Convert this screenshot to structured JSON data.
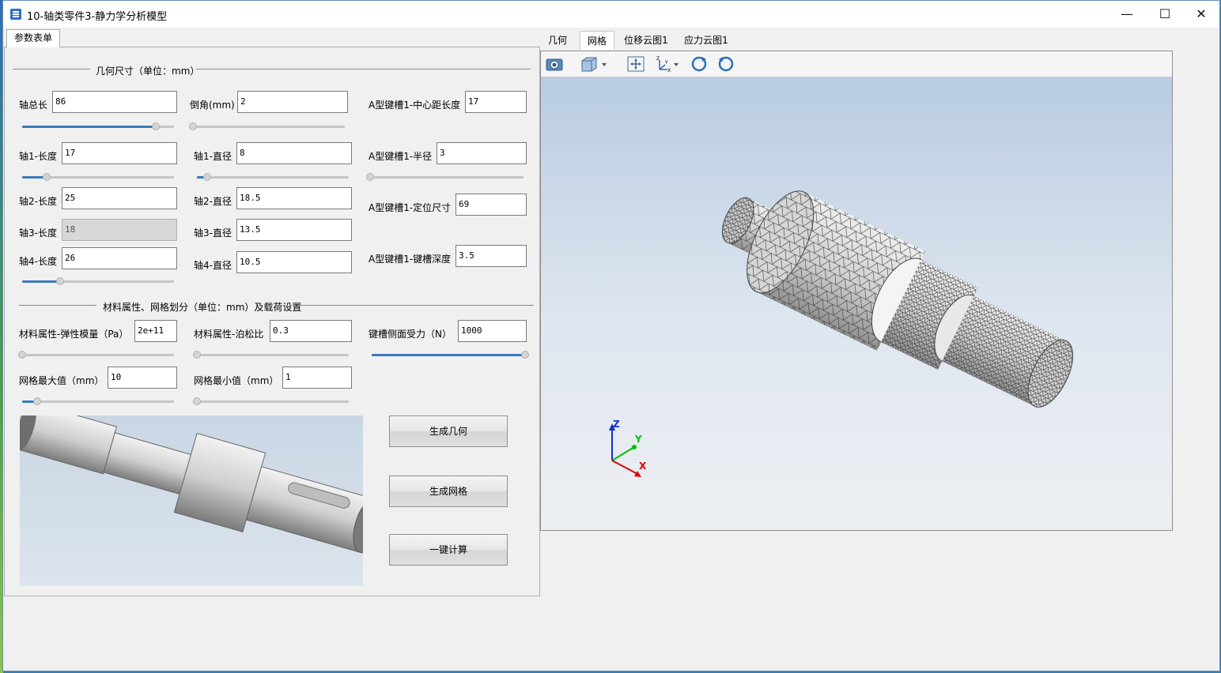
{
  "window": {
    "title": "10-轴类零件3-静力学分析模型"
  },
  "left_panel": {
    "tab": "参数表单",
    "section1": "几何尺寸（单位：mm）",
    "section2": "材料属性、网格划分（单位：mm）及载荷设置",
    "fields": {
      "total_length": {
        "label": "轴总长",
        "value": "86"
      },
      "chamfer": {
        "label": "倒角(mm)",
        "value": "2"
      },
      "key_center": {
        "label": "A型键槽1-中心距长度",
        "value": "17"
      },
      "s1_len": {
        "label": "轴1-长度",
        "value": "17"
      },
      "s1_dia": {
        "label": "轴1-直径",
        "value": "8"
      },
      "key_radius": {
        "label": "A型键槽1-半径",
        "value": "3"
      },
      "s2_len": {
        "label": "轴2-长度",
        "value": "25"
      },
      "s2_dia": {
        "label": "轴2-直径",
        "value": "18.5"
      },
      "key_pos": {
        "label": "A型键槽1-定位尺寸",
        "value": "69"
      },
      "s3_len": {
        "label": "轴3-长度",
        "value": "18"
      },
      "s3_dia": {
        "label": "轴3-直径",
        "value": "13.5"
      },
      "s4_len": {
        "label": "轴4-长度",
        "value": "26"
      },
      "s4_dia": {
        "label": "轴4-直径",
        "value": "10.5"
      },
      "key_depth": {
        "label": "A型键槽1-键槽深度",
        "value": "3.5"
      },
      "elastic": {
        "label": "材料属性-弹性模量（Pa）",
        "value": "2e+11"
      },
      "poisson": {
        "label": "材料属性-泊松比",
        "value": "0.3"
      },
      "force": {
        "label": "键槽侧面受力（N）",
        "value": "1000"
      },
      "mesh_max": {
        "label": "网格最大值（mm）",
        "value": "10"
      },
      "mesh_min": {
        "label": "网格最小值（mm）",
        "value": "1"
      }
    },
    "sliders": {
      "total_length": 0.88,
      "chamfer": 0.0,
      "s1_len": 0.16,
      "s1_dia": 0.07,
      "key_radius": 0.0,
      "s4_len": 0.25,
      "elastic": 0.0,
      "poisson": 0.0,
      "force": 1.0,
      "mesh_max": 0.1,
      "mesh_min": 0.0
    },
    "buttons": {
      "gen_geometry": "生成几何",
      "gen_mesh": "生成网格",
      "compute": "一键计算"
    }
  },
  "right_panel": {
    "tabs": [
      "几何",
      "网格",
      "位移云图1",
      "应力云图1"
    ],
    "active_tab": 1,
    "axes": {
      "z": "Z",
      "y": "Y",
      "x": "X"
    }
  },
  "colors": {
    "accent": "#3a7abf",
    "axis_x": "#e00000",
    "axis_y": "#00c000",
    "axis_z": "#1030d0"
  },
  "icons": [
    "camera-icon",
    "cube-view-icon",
    "fit-view-icon",
    "axis-orient-icon",
    "rotate-cw-icon",
    "rotate-ccw-icon"
  ]
}
